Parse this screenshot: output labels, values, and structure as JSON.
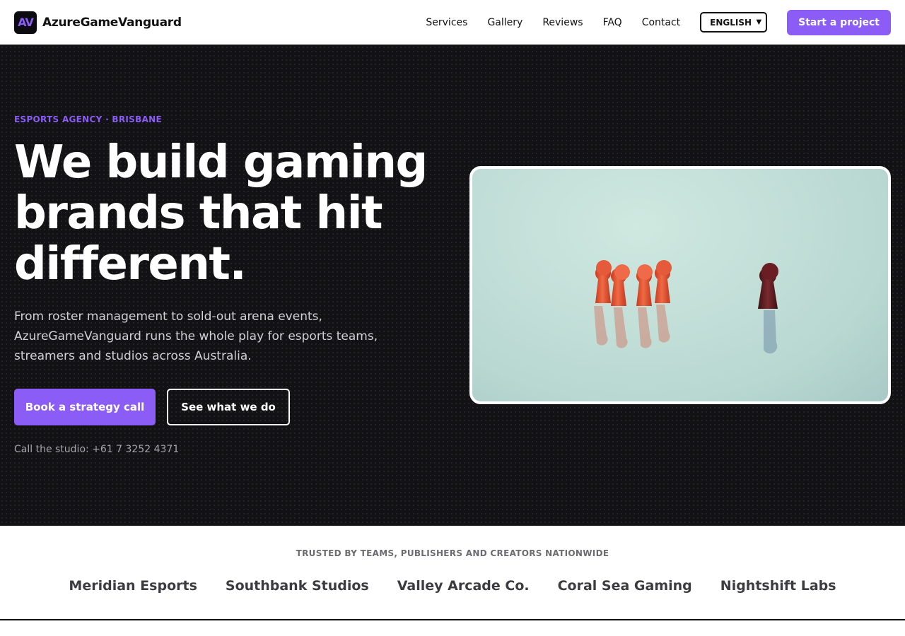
{
  "nav": {
    "logo_mark": "AV",
    "brand": "AzureGameVanguard",
    "links": [
      "Services",
      "Gallery",
      "Reviews",
      "FAQ",
      "Contact"
    ],
    "language": "ENGLISH",
    "cta": "Start a project"
  },
  "hero": {
    "eyebrow": "ESPORTS AGENCY · BRISBANE",
    "headline": "We build gaming brands that hit different.",
    "subcopy": "From roster management to sold-out arena events, AzureGameVanguard runs the whole play for esports teams, streamers and studios across Australia.",
    "primary_button": "Book a strategy call",
    "secondary_button": "See what we do",
    "phone": "Call the studio: +61 7 3252 4371"
  },
  "trusted": {
    "caption": "TRUSTED BY TEAMS, PUBLISHERS AND CREATORS NATIONWIDE",
    "logos": [
      "Meridian Esports",
      "Southbank Studios",
      "Valley Arcade Co.",
      "Coral Sea Gaming",
      "Nightshift Labs"
    ]
  },
  "colors": {
    "accent": "#8b5cf6",
    "hero_bg": "#121214",
    "pawn_red": "#e2502e",
    "pawn_dark": "#5a1a1e"
  },
  "icons": {
    "select_chevron": "chevron-down-icon"
  }
}
